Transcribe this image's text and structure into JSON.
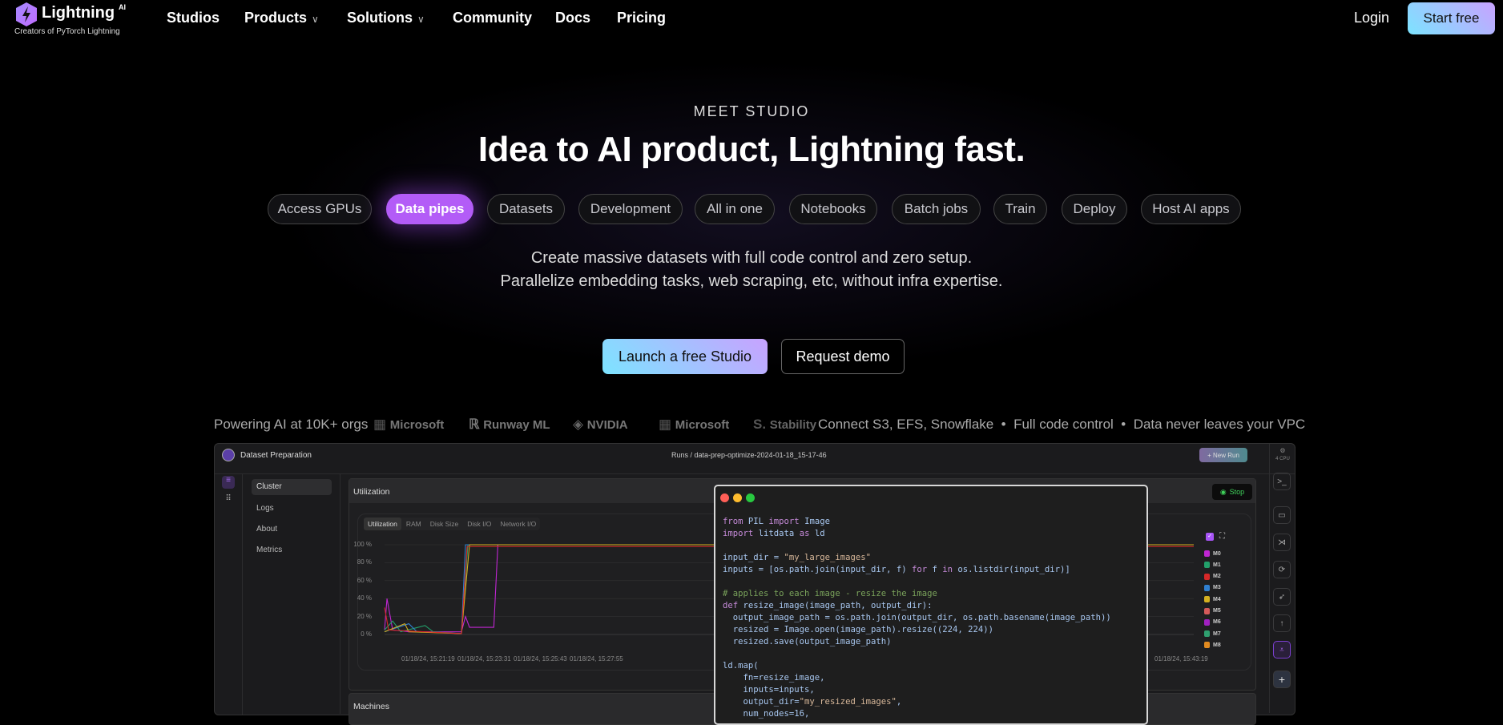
{
  "nav": {
    "brand": "Lightning",
    "brand_sup": "AI",
    "tagline": "Creators of PyTorch Lightning",
    "items": [
      {
        "label": "Studios",
        "dropdown": false
      },
      {
        "label": "Products",
        "dropdown": true
      },
      {
        "label": "Solutions",
        "dropdown": true
      },
      {
        "label": "Community",
        "dropdown": false
      },
      {
        "label": "Docs",
        "dropdown": false
      },
      {
        "label": "Pricing",
        "dropdown": false
      }
    ],
    "login": "Login",
    "start_free": "Start free"
  },
  "hero": {
    "eyebrow": "MEET STUDIO",
    "title": "Idea to AI product, Lightning fast.",
    "pills": [
      "Access GPUs",
      "Data pipes",
      "Datasets",
      "Development",
      "All in one",
      "Notebooks",
      "Batch jobs",
      "Train",
      "Deploy",
      "Host AI apps"
    ],
    "active_pill": "Data pipes",
    "desc_line1": "Create massive datasets with full code control and zero setup.",
    "desc_line2": "Parallelize embedding tasks, web scraping, etc, without infra expertise.",
    "cta_primary": "Launch a free Studio",
    "cta_secondary": "Request demo"
  },
  "trust": {
    "powering": "Powering AI at 10K+ orgs",
    "logos": [
      "Microsoft",
      "Runway ML",
      "NVIDIA",
      "Microsoft",
      "Stability"
    ],
    "features": [
      "Connect S3, EFS, Snowflake",
      "Full code control",
      "Data never leaves your VPC"
    ]
  },
  "app": {
    "title": "Dataset Preparation",
    "breadcrumb": "Runs / data-prep-optimize-2024-01-18_15-17-46",
    "new_run": "+ New Run",
    "gpu_label": "4 CPU",
    "sidebar": [
      "Cluster",
      "Logs",
      "About",
      "Metrics"
    ],
    "utilization_title": "Utilization",
    "stop": "Stop",
    "tabs": [
      "Utilization",
      "RAM",
      "Disk Size",
      "Disk I/O",
      "Network I/O"
    ],
    "machines_title": "Machines",
    "legend": [
      {
        "name": "M0",
        "color": "#c026d3"
      },
      {
        "name": "M1",
        "color": "#22a06b"
      },
      {
        "name": "M2",
        "color": "#d62828"
      },
      {
        "name": "M3",
        "color": "#2f7fd0"
      },
      {
        "name": "M4",
        "color": "#d4b020"
      },
      {
        "name": "M5",
        "color": "#d45a5a"
      },
      {
        "name": "M6",
        "color": "#a020c0"
      },
      {
        "name": "M7",
        "color": "#2fa070"
      },
      {
        "name": "M8",
        "color": "#e08a20"
      }
    ]
  },
  "chart_data": {
    "type": "line",
    "y_ticks": [
      "100 %",
      "80 %",
      "60 %",
      "40 %",
      "20 %",
      "0 %"
    ],
    "x_ticks": [
      "01/18/24, 15:21:19",
      "01/18/24, 15:23:31",
      "01/18/24, 15:25:43",
      "01/18/24, 15:27:55",
      "01/18/24, 15:43:19"
    ],
    "ylim": [
      0,
      100
    ],
    "series": [
      {
        "name": "M0",
        "points": [
          [
            0,
            5
          ],
          [
            0.3,
            40
          ],
          [
            1,
            5
          ],
          [
            3,
            3
          ],
          [
            9.5,
            3
          ],
          [
            10,
            20
          ],
          [
            10.5,
            8
          ],
          [
            13.5,
            8
          ],
          [
            14,
            100
          ],
          [
            100,
            100
          ]
        ]
      },
      {
        "name": "M1",
        "points": [
          [
            0,
            5
          ],
          [
            1,
            15
          ],
          [
            2,
            3
          ],
          [
            5,
            10
          ],
          [
            6,
            3
          ],
          [
            9.5,
            1
          ],
          [
            10.3,
            100
          ],
          [
            100,
            100
          ]
        ]
      },
      {
        "name": "M3",
        "points": [
          [
            0,
            3
          ],
          [
            3,
            12
          ],
          [
            4,
            3
          ],
          [
            9.5,
            1
          ],
          [
            10,
            100
          ],
          [
            100,
            100
          ]
        ]
      },
      {
        "name": "M4",
        "points": [
          [
            0,
            3
          ],
          [
            2.5,
            12
          ],
          [
            3,
            3
          ],
          [
            9.5,
            1
          ],
          [
            10.5,
            100
          ],
          [
            100,
            100
          ]
        ]
      },
      {
        "name": "M2",
        "points": [
          [
            0,
            30
          ],
          [
            0.5,
            5
          ],
          [
            9.5,
            1
          ],
          [
            10.2,
            98
          ],
          [
            100,
            98
          ]
        ]
      }
    ]
  },
  "code": [
    [
      [
        "from",
        "kw"
      ],
      [
        " PIL ",
        "pl"
      ],
      [
        "import",
        "kw"
      ],
      [
        " Image",
        "pl"
      ]
    ],
    [
      [
        "import",
        "kw"
      ],
      [
        " litdata ",
        "pl"
      ],
      [
        "as",
        "kw"
      ],
      [
        " ld",
        "pl"
      ]
    ],
    [],
    [
      [
        "input_dir = ",
        "pl"
      ],
      [
        "\"my_large_images\"",
        "str"
      ]
    ],
    [
      [
        "inputs = [os.path.join(input_dir, f) ",
        "pl"
      ],
      [
        "for",
        "kw"
      ],
      [
        " f ",
        "pl"
      ],
      [
        "in",
        "kw"
      ],
      [
        " os.listdir(input_dir)]",
        "pl"
      ]
    ],
    [],
    [
      [
        "# applies to each image - resize the image",
        "cm"
      ]
    ],
    [
      [
        "def",
        "kw"
      ],
      [
        " resize_image(image_path, output_dir):",
        "pl"
      ]
    ],
    [
      [
        "  output_image_path = os.path.join(output_dir, os.path.basename(image_path))",
        "pl"
      ]
    ],
    [
      [
        "  resized = Image.open(image_path).resize((224, 224))",
        "pl"
      ]
    ],
    [
      [
        "  resized.save(output_image_path)",
        "pl"
      ]
    ],
    [],
    [
      [
        "ld.map(",
        "pl"
      ]
    ],
    [
      [
        "    fn=resize_image,",
        "pl"
      ]
    ],
    [
      [
        "    inputs=inputs,",
        "pl"
      ]
    ],
    [
      [
        "    output_dir=",
        "pl"
      ],
      [
        "\"my_resized_images\"",
        "str"
      ],
      [
        ",",
        "pl"
      ]
    ],
    [
      [
        "    num_nodes=16,",
        "pl"
      ]
    ]
  ]
}
